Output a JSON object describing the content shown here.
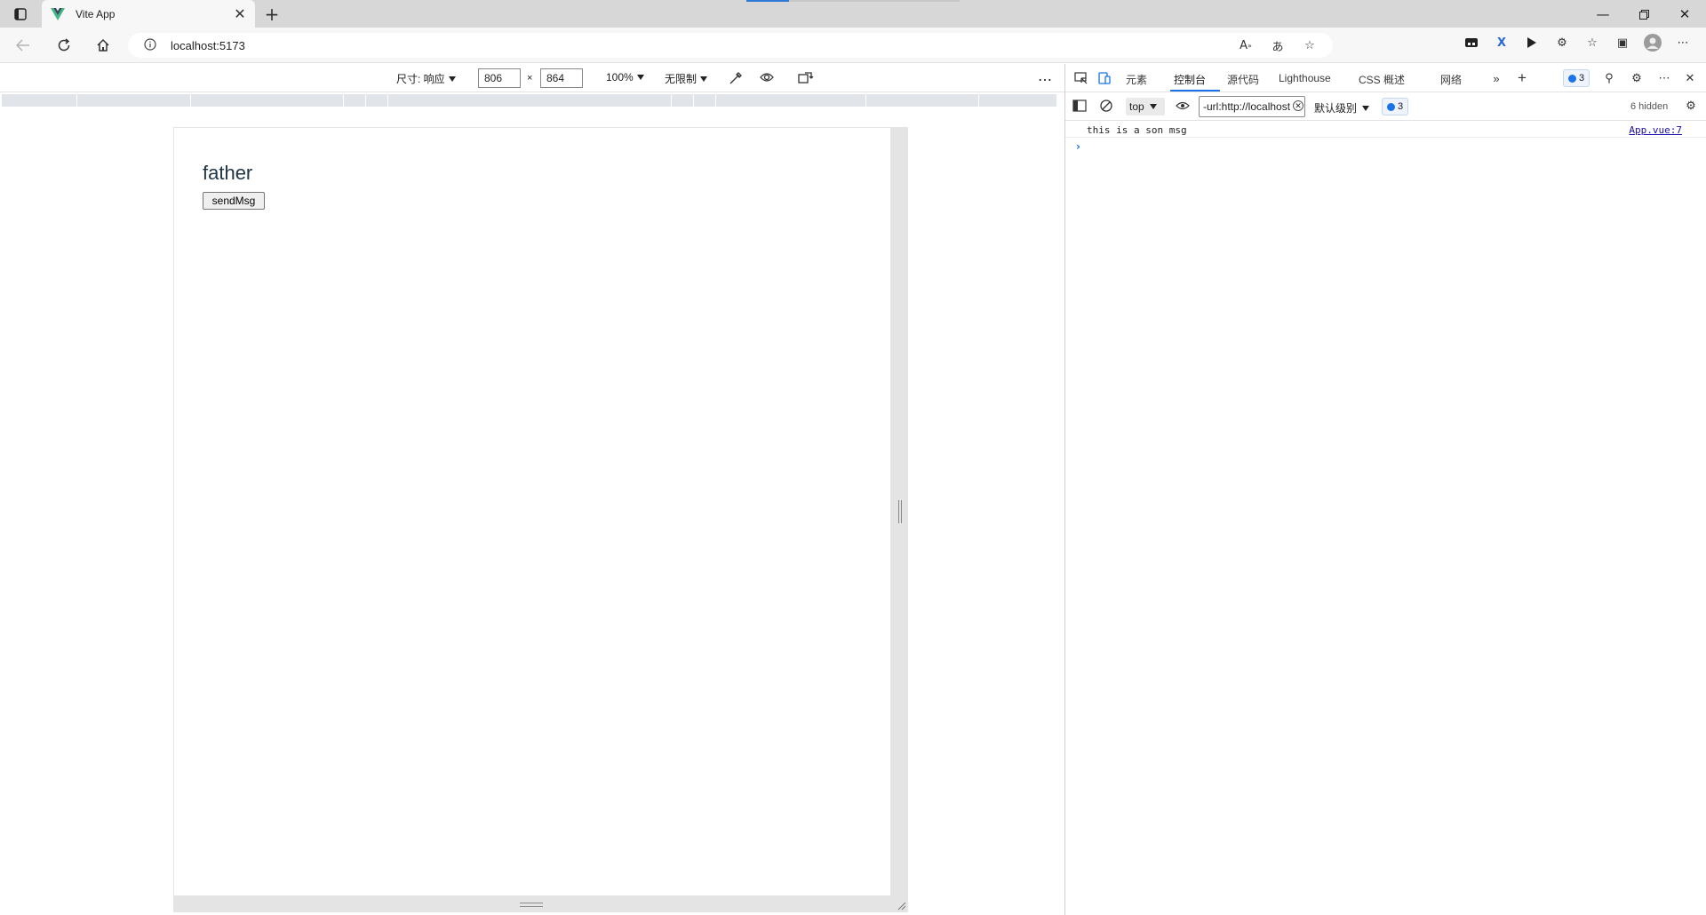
{
  "browser": {
    "tab_title": "Vite App",
    "url": "localhost:5173"
  },
  "device_toolbar": {
    "dimensions_label": "尺寸: 响应",
    "width_value": "806",
    "height_value": "864",
    "times_sign": "×",
    "zoom": "100%",
    "throttle": "无限制",
    "more": "⋯"
  },
  "page": {
    "heading": "father",
    "button_label": "sendMsg"
  },
  "devtools": {
    "tabs": [
      "元素",
      "控制台",
      "源代码",
      "Lighthouse",
      "CSS 概述",
      "网络"
    ],
    "active_tab": "控制台",
    "issues_badge": "3",
    "context": "top",
    "filter_value": "-url:http://localhost",
    "level": "默认级别",
    "messages_badge": "3",
    "hidden_count": "6 hidden",
    "log_message": "this is a son msg",
    "log_source": "App.vue:7",
    "prompt_symbol": "›"
  },
  "colors": {
    "accent": "#1a73e8",
    "vue_green": "#41b883",
    "vue_dark": "#35495e",
    "heading": "#213547"
  }
}
